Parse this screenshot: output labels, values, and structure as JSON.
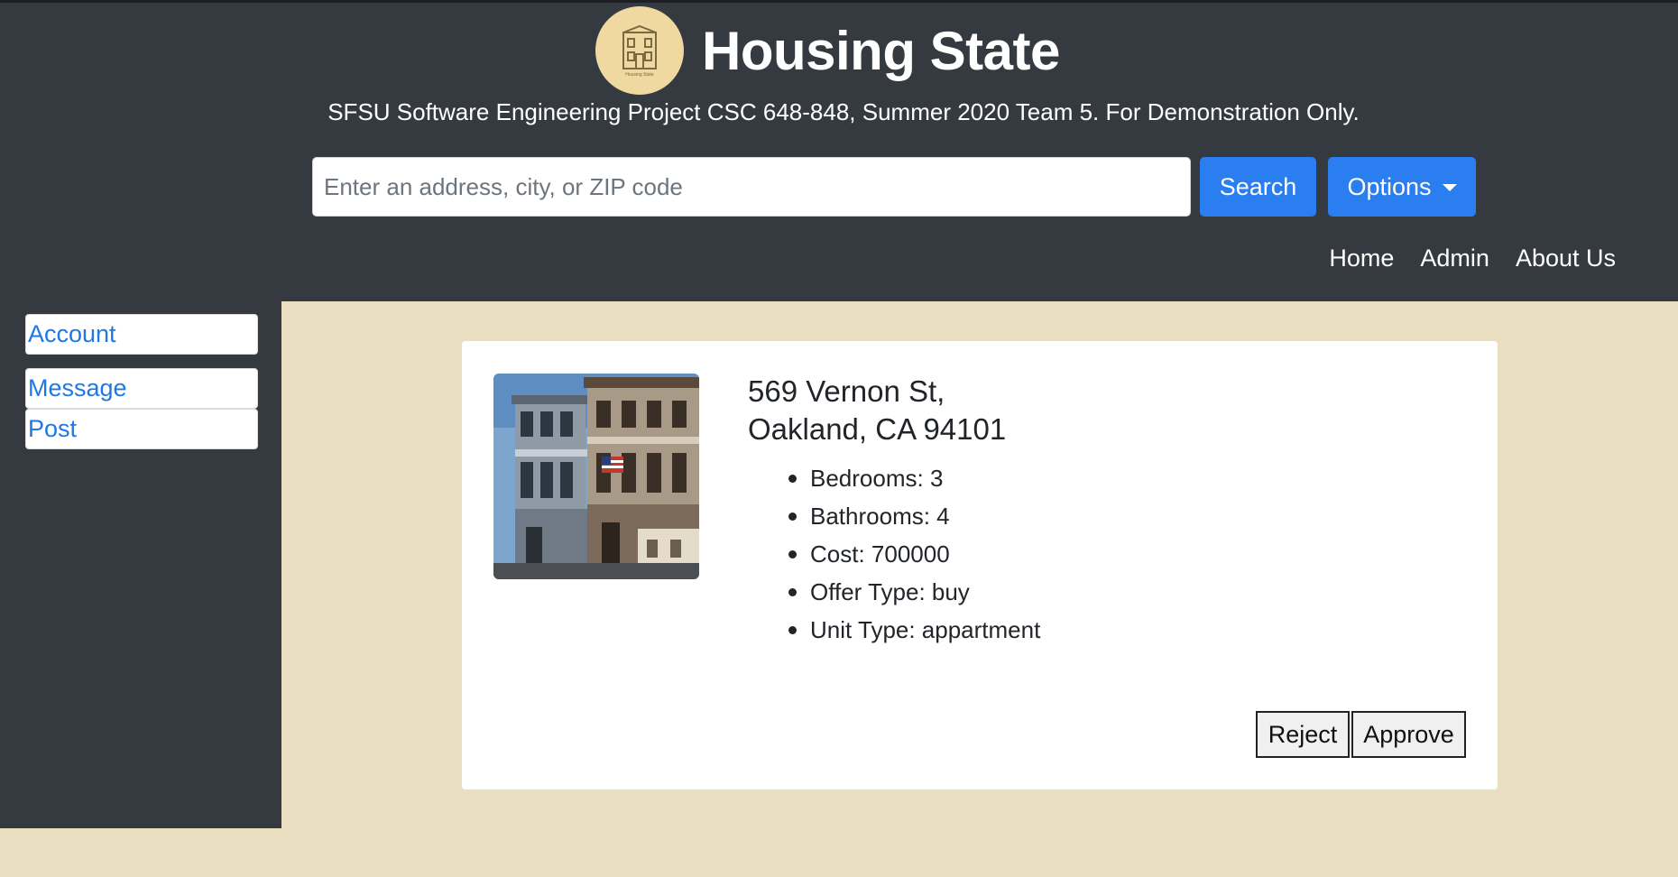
{
  "header": {
    "brand_title": "Housing State",
    "logo_caption": "Housing State",
    "subtitle": "SFSU Software Engineering Project CSC 648-848, Summer 2020 Team 5. For Demonstration Only.",
    "search_placeholder": "Enter an address, city, or ZIP code",
    "search_label": "Search",
    "options_label": "Options",
    "nav": [
      "Home",
      "Admin",
      "About Us"
    ]
  },
  "sidebar": {
    "items": [
      "Account",
      "Message",
      "Post"
    ]
  },
  "listing": {
    "address_line1": "569 Vernon St,",
    "address_line2": "Oakland, CA 94101",
    "details": [
      "Bedrooms: 3",
      "Bathrooms: 4",
      "Cost: 700000",
      "Offer Type: buy",
      "Unit Type: appartment"
    ],
    "image_icon": "house-photo"
  },
  "actions": {
    "reject_label": "Reject",
    "approve_label": "Approve"
  },
  "colors": {
    "header_bg": "#343a40",
    "page_bg": "#e9dec0",
    "accent": "#2a7ef0",
    "logo_bg": "#efd9a0"
  }
}
